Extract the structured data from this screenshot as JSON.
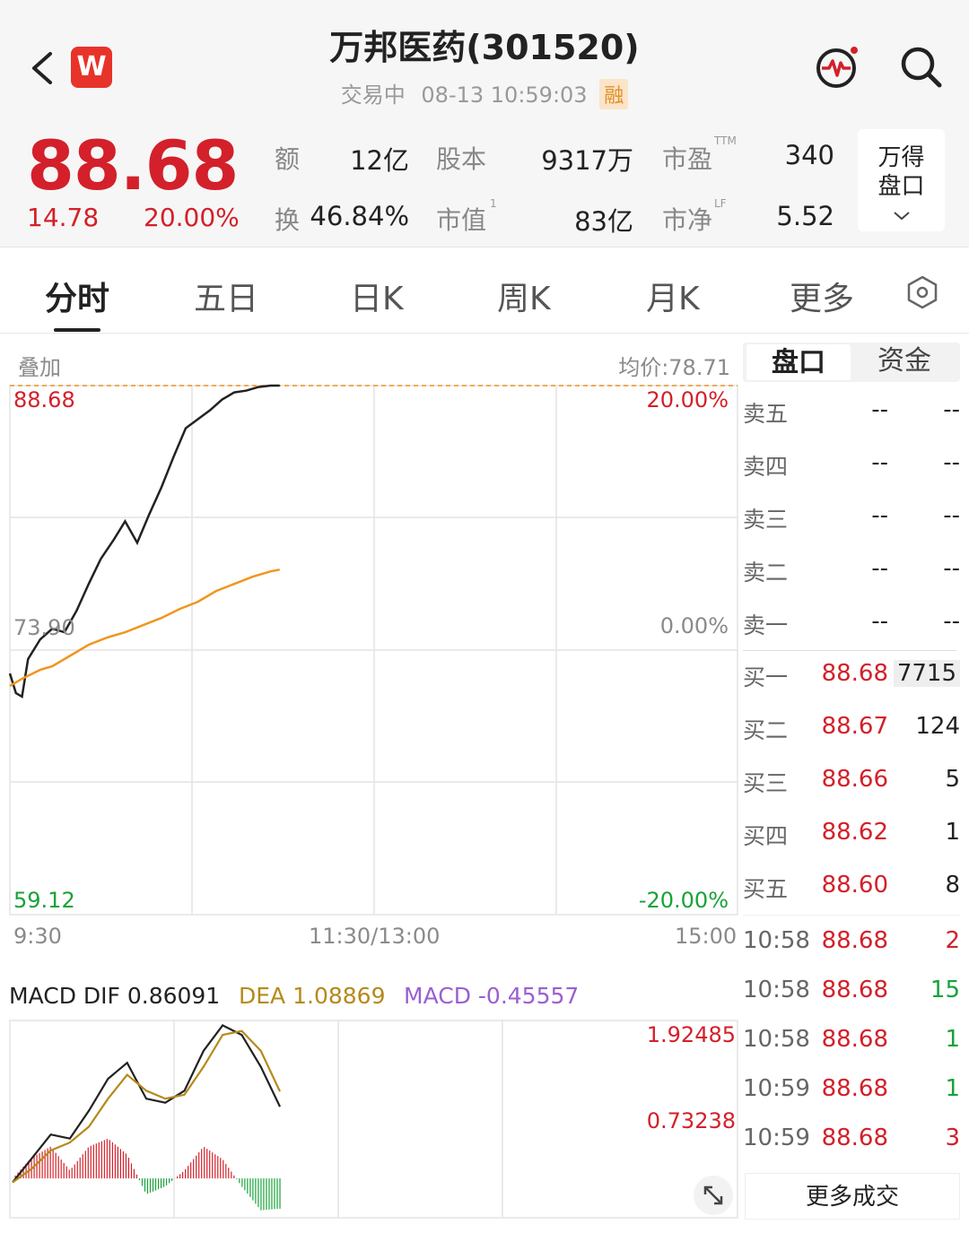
{
  "header": {
    "title": "万邦医药(301520)",
    "status": "交易中",
    "datetime": "08-13 10:59:03",
    "margin_badge": "融",
    "logo_letter": "W"
  },
  "quote": {
    "price": "88.68",
    "change": "14.78",
    "change_pct": "20.00%",
    "stats": [
      {
        "label": "额",
        "sup": "",
        "value": "12亿"
      },
      {
        "label": "股本",
        "sup": "",
        "value": "9317万"
      },
      {
        "label": "市盈",
        "sup": "TTM",
        "value": "340"
      },
      {
        "label": "换",
        "sup": "",
        "value": "46.84%"
      },
      {
        "label": "市值",
        "sup": "1",
        "value": "83亿"
      },
      {
        "label": "市净",
        "sup": "LF",
        "value": "5.52"
      }
    ],
    "wind_button_line1": "万得",
    "wind_button_line2": "盘口"
  },
  "tabs": [
    "分时",
    "五日",
    "日K",
    "周K",
    "月K",
    "更多"
  ],
  "chart": {
    "overlay_label": "叠加",
    "avg_price": "均价:78.71",
    "y_top": "88.68",
    "y_mid": "73.90",
    "y_bottom": "59.12",
    "pct_top": "20.00%",
    "pct_mid": "0.00%",
    "pct_bottom": "-20.00%",
    "x_labels": [
      "9:30",
      "11:30/13:00",
      "15:00"
    ]
  },
  "chart_data": [
    {
      "type": "line",
      "title": "",
      "x_range": [
        "9:30",
        "15:00"
      ],
      "ylim": [
        59.12,
        88.68
      ],
      "series": [
        {
          "name": "",
          "color": "#222222",
          "x": [
            0,
            2,
            4,
            6,
            10,
            14,
            18,
            22,
            26,
            30,
            34,
            38,
            42,
            46,
            50,
            54,
            58,
            62,
            66,
            70,
            74,
            78,
            82,
            86,
            89
          ],
          "y": [
            72.6,
            71.5,
            71.3,
            73.4,
            74.5,
            75.1,
            74.9,
            76.1,
            77.6,
            79.0,
            80.0,
            81.1,
            79.9,
            81.5,
            83.0,
            84.7,
            86.3,
            86.8,
            87.3,
            87.9,
            88.3,
            88.4,
            88.6,
            88.68,
            88.68
          ]
        },
        {
          "name": "",
          "color": "#f0961e",
          "x": [
            0,
            2,
            4,
            10,
            14,
            20,
            26,
            32,
            38,
            44,
            50,
            56,
            62,
            68,
            74,
            80,
            86,
            89
          ],
          "y": [
            71.9,
            72.1,
            72.3,
            72.8,
            73.0,
            73.6,
            74.2,
            74.6,
            74.9,
            75.3,
            75.7,
            76.2,
            76.6,
            77.2,
            77.6,
            78.0,
            78.3,
            78.4
          ]
        }
      ]
    },
    {
      "type": "line",
      "title": "",
      "ylim": [
        -0.46,
        1.92485
      ],
      "series": [
        {
          "name": "DIF",
          "color": "#222222",
          "values": [
            -0.05,
            0.25,
            0.55,
            0.5,
            0.85,
            1.25,
            1.45,
            1.0,
            0.95,
            1.1,
            1.6,
            1.92,
            1.8,
            1.4,
            0.9
          ]
        },
        {
          "name": "DEA",
          "color": "#b58a1a",
          "values": [
            -0.05,
            0.12,
            0.35,
            0.45,
            0.65,
            1.0,
            1.3,
            1.1,
            1.0,
            1.05,
            1.4,
            1.8,
            1.85,
            1.6,
            1.09
          ]
        }
      ]
    }
  ],
  "macd": {
    "dif_label": "MACD DIF 0.86091",
    "dea_label": "DEA 1.08869",
    "macd_label": "MACD -0.45557",
    "y_top": "1.92485",
    "y_mid": "0.73238"
  },
  "order_book": {
    "tabs": [
      "盘口",
      "资金"
    ],
    "asks": [
      {
        "label": "卖五",
        "price": "--",
        "vol": "--"
      },
      {
        "label": "卖四",
        "price": "--",
        "vol": "--"
      },
      {
        "label": "卖三",
        "price": "--",
        "vol": "--"
      },
      {
        "label": "卖二",
        "price": "--",
        "vol": "--"
      },
      {
        "label": "卖一",
        "price": "--",
        "vol": "--"
      }
    ],
    "bids": [
      {
        "label": "买一",
        "price": "88.68",
        "vol": "7715"
      },
      {
        "label": "买二",
        "price": "88.67",
        "vol": "124"
      },
      {
        "label": "买三",
        "price": "88.66",
        "vol": "5"
      },
      {
        "label": "买四",
        "price": "88.62",
        "vol": "1"
      },
      {
        "label": "买五",
        "price": "88.60",
        "vol": "8"
      }
    ],
    "trades": [
      {
        "time": "10:58",
        "price": "88.68",
        "vol": "2"
      },
      {
        "time": "10:58",
        "price": "88.68",
        "vol": "15"
      },
      {
        "time": "10:58",
        "price": "88.68",
        "vol": "1"
      },
      {
        "time": "10:59",
        "price": "88.68",
        "vol": "1"
      },
      {
        "time": "10:59",
        "price": "88.68",
        "vol": "3"
      }
    ],
    "more_trades": "更多成交"
  }
}
